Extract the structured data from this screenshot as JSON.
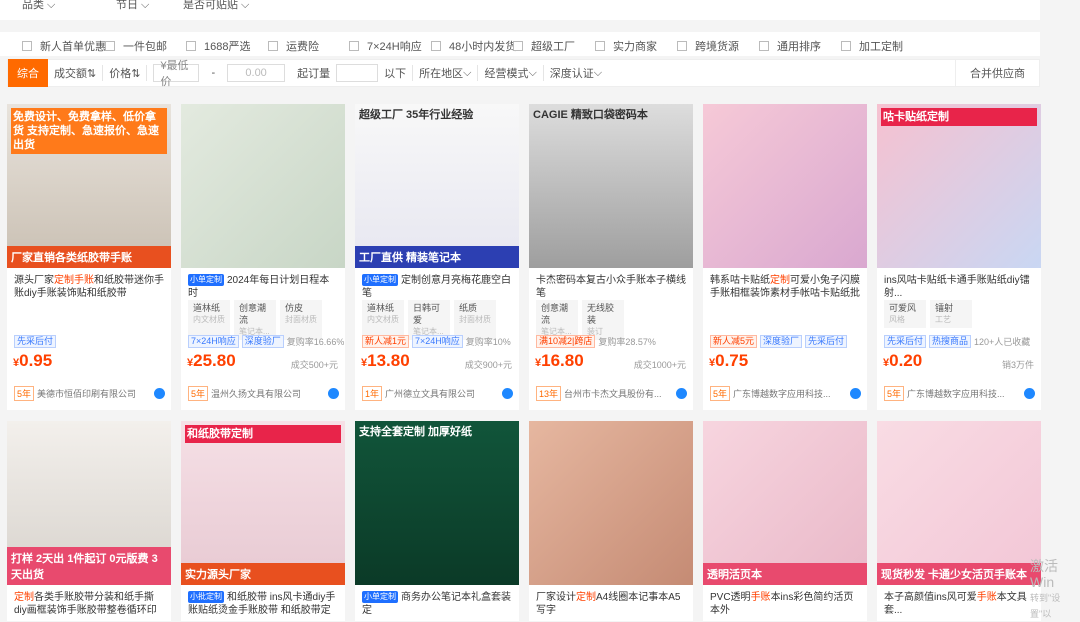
{
  "top_filters": [
    "品类",
    "节日",
    "是否可贴贴"
  ],
  "checkboxes": [
    "新人首单优惠",
    "一件包邮",
    "1688严选",
    "运费险",
    "7×24H响应",
    "48小时内发货",
    "超级工厂",
    "实力商家",
    "跨境货源",
    "通用排序",
    "加工定制"
  ],
  "sortbar": {
    "active": "综合",
    "sales": "成交额",
    "price": "价格",
    "min_label": "¥最低价",
    "dash": "-",
    "max_ph": "0.00",
    "moq": "起订量",
    "below": "以下",
    "area": "所在地区",
    "mode": "经营模式",
    "depth": "深度认证",
    "merge": "合并供应商"
  },
  "colors": {
    "accent": "#ff6a00",
    "price": "#ff4000",
    "badge_blue": "#1f6fff"
  },
  "products": [
    {
      "title_pre": "源头厂家",
      "title_hl": "定制手账",
      "title_post": "和纸胶带迷你手账diy手账装饰贴和纸胶带",
      "tag": "",
      "attrs": [],
      "badges": [
        [
          "先采后付",
          "b"
        ]
      ],
      "price_int": "0.95",
      "sold": "",
      "years": "5年",
      "company": "美德市恒佰印刷有限公司",
      "img_text": "免费设计、免费拿样、低价拿货 支持定制、急速报价、急速出货",
      "img_bottom": "厂家直销各类纸胶带手账"
    },
    {
      "title_pre": "",
      "title_hl": "",
      "title_post": "2024年每日计划日程本 时",
      "tag": "小单定制",
      "attrs": [
        [
          "道林纸",
          "内文材质"
        ],
        [
          "创意潮流",
          "笔记本..."
        ],
        [
          "仿皮",
          "封面材质"
        ]
      ],
      "badges": [
        [
          "7×24H响应",
          "b"
        ],
        [
          "深度验厂",
          "b"
        ]
      ],
      "extra": "复购率16.66%",
      "price_int": "25.80",
      "sold": "成交500+元",
      "years": "5年",
      "company": "温州久扬文具有限公司",
      "img_text": "",
      "img_bottom": ""
    },
    {
      "title_pre": "",
      "title_hl": "",
      "title_post": "定制创意月亮梅花鹿空白笔",
      "tag": "小单定制",
      "attrs": [
        [
          "道林纸",
          "内文材质"
        ],
        [
          "日韩可爱",
          "笔记本..."
        ],
        [
          "纸质",
          "封面材质"
        ]
      ],
      "badges": [
        [
          "新人减1元",
          "r"
        ],
        [
          "7×24H响应",
          "b"
        ]
      ],
      "extra": "复购率10%",
      "price_int": "13.80",
      "sold": "成交900+元",
      "years": "1年",
      "company": "广州德立文具有限公司",
      "img_text": "超级工厂 35年行业经验",
      "img_bottom": "工厂直供 精装笔记本"
    },
    {
      "title_pre": "卡杰密码本复古小众手账本子横线笔",
      "title_hl": "",
      "title_post": "",
      "tag": "",
      "attrs": [
        [
          "创意潮流",
          "笔记本..."
        ],
        [
          "无线胶装",
          "装订"
        ]
      ],
      "badges": [
        [
          "满10减2|跨店",
          "r"
        ]
      ],
      "extra": "复购率28.57%",
      "price_int": "16.80",
      "sold": "成交1000+元",
      "years": "13年",
      "company": "台州市卡杰文具股份有...",
      "img_text": "CAGIE 精致口袋密码本",
      "img_bottom": ""
    },
    {
      "title_pre": "韩系咕卡贴纸",
      "title_hl": "定制",
      "title_post": "可爱小兔子闪膜手账相框装饰素材手帐咕卡贴纸批",
      "tag": "",
      "attrs": [],
      "badges": [
        [
          "新人减5元",
          "r"
        ],
        [
          "深度验厂",
          "b"
        ],
        [
          "先采后付",
          "b"
        ]
      ],
      "price_int": "0.75",
      "sold": "",
      "years": "5年",
      "company": "广东博越数字应用科技...",
      "img_text": "",
      "img_bottom": ""
    },
    {
      "title_pre": "ins风咕卡贴纸卡通手账贴纸diy镭射...",
      "title_hl": "",
      "title_post": "",
      "tag": "",
      "attrs": [
        [
          "可爱风",
          "风格"
        ],
        [
          "镭射",
          "工艺"
        ]
      ],
      "badges": [
        [
          "先采后付",
          "b"
        ],
        [
          "热搜商品",
          "b"
        ]
      ],
      "extra": "120+人已收藏",
      "price_int": "0.20",
      "sold": "销3万件",
      "years": "5年",
      "company": "广东博越数字应用科技...",
      "img_text": "咕卡贴纸定制",
      "img_bottom": ""
    },
    {
      "title_pre": "",
      "title_hl": "定制",
      "title_post": "各类手账胶带分装和纸手撕diy画框装饰手账胶带整卷循环印刷",
      "tag": "",
      "img_bottom": "打样 2天出 1件起订 0元版费 3天出货"
    },
    {
      "title_pre": "",
      "title_hl": "",
      "title_post": "和纸胶带 ins风卡通diy手账贴纸烫金手账胶带 和纸胶带定做小批",
      "tag": "小批定制",
      "img_text": "和纸胶带定制",
      "img_bottom": "实力源头厂家"
    },
    {
      "title_pre": "",
      "title_hl": "",
      "title_post": "商务办公笔记本礼盒套装定",
      "tag": "小单定制",
      "img_text": "支持全套定制 加厚好纸",
      "img_bottom": ""
    },
    {
      "title_pre": "厂家设计",
      "title_hl": "定制",
      "title_post": "A4线圈本记事本A5写字",
      "tag": "",
      "img_text": "",
      "img_bottom": ""
    },
    {
      "title_pre": "PVC透明",
      "title_hl": "手账",
      "title_post": "本ins彩色简约活页本外",
      "tag": "",
      "img_text": "",
      "img_bottom": "透明活页本"
    },
    {
      "title_pre": "本子高颜值ins风可爱",
      "title_hl": "手账",
      "title_post": "本文具套...",
      "tag": "",
      "img_text": "",
      "img_bottom": "现货秒发 卡通少女活页手账本"
    }
  ],
  "watermark": {
    "line1": "激活 Win",
    "line2": "转到\"设置\"以"
  }
}
